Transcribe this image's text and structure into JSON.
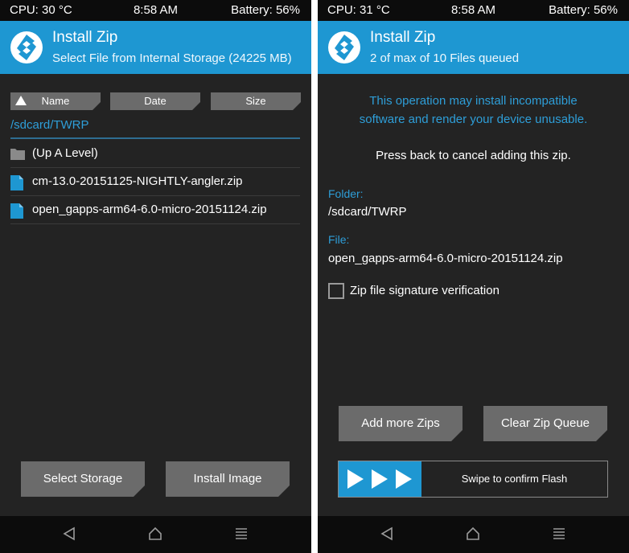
{
  "left": {
    "status": {
      "cpu": "CPU: 30 °C",
      "time": "8:58 AM",
      "battery": "Battery: 56%"
    },
    "header": {
      "title": "Install Zip",
      "subtitle": "Select File from Internal Storage (24225 MB)"
    },
    "sort": {
      "name": "Name",
      "date": "Date",
      "size": "Size"
    },
    "path": "/sdcard/TWRP",
    "files": [
      {
        "label": "(Up A Level)",
        "icon": "folder-icon"
      },
      {
        "label": "cm-13.0-20151125-NIGHTLY-angler.zip",
        "icon": "file-icon"
      },
      {
        "label": "open_gapps-arm64-6.0-micro-20151124.zip",
        "icon": "file-icon"
      }
    ],
    "buttons": {
      "select_storage": "Select Storage",
      "install_image": "Install Image"
    }
  },
  "right": {
    "status": {
      "cpu": "CPU: 31 °C",
      "time": "8:58 AM",
      "battery": "Battery: 56%"
    },
    "header": {
      "title": "Install Zip",
      "subtitle": "2 of max of 10 Files queued"
    },
    "warning_line1": "This operation may install incompatible",
    "warning_line2": "software and render your device unusable.",
    "press_back": "Press back to cancel adding this zip.",
    "folder_label": "Folder:",
    "folder_value": "/sdcard/TWRP",
    "file_label": "File:",
    "file_value": "open_gapps-arm64-6.0-micro-20151124.zip",
    "checkbox_label": "Zip file signature verification",
    "checkbox_checked": false,
    "buttons": {
      "add_more": "Add more Zips",
      "clear_queue": "Clear Zip Queue"
    },
    "swipe_label": "Swipe to confirm Flash"
  },
  "colors": {
    "accent": "#1e97d2",
    "background": "#232323",
    "button": "#6b6b6b",
    "text_accent": "#2e9ed8"
  }
}
